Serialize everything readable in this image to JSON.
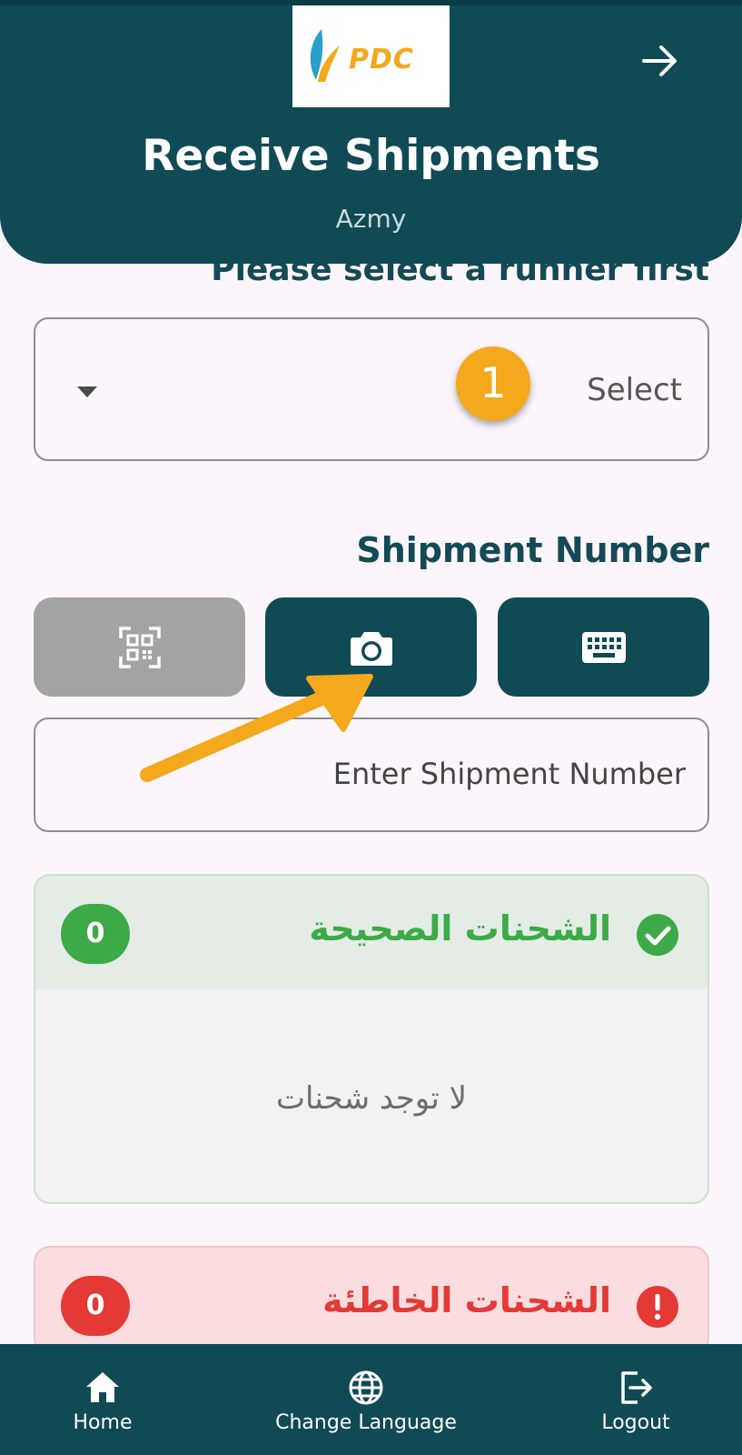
{
  "header": {
    "logo_text": "PDC",
    "title": "Receive Shipments",
    "user_name": "Azmy"
  },
  "runner": {
    "heading": "Please select a runner first",
    "select_value": "Select",
    "step_badge": "1"
  },
  "shipment": {
    "heading": "Shipment Number",
    "input_placeholder": "Enter Shipment Number",
    "modes": [
      "qr-scan",
      "camera",
      "keyboard"
    ],
    "active_mode": "camera"
  },
  "cards": {
    "valid": {
      "title": "الشحنات الصحيحة",
      "count": "0",
      "empty_text": "لا توجد شحنات",
      "color": "#3daa48"
    },
    "invalid": {
      "title": "الشحنات الخاطئة",
      "count": "0",
      "color": "#e53935"
    }
  },
  "nav": {
    "home": "Home",
    "change_language": "Change Language",
    "logout": "Logout"
  },
  "colors": {
    "primary": "#104a55",
    "accent": "#f4a81b",
    "background": "#fcf6fc"
  }
}
